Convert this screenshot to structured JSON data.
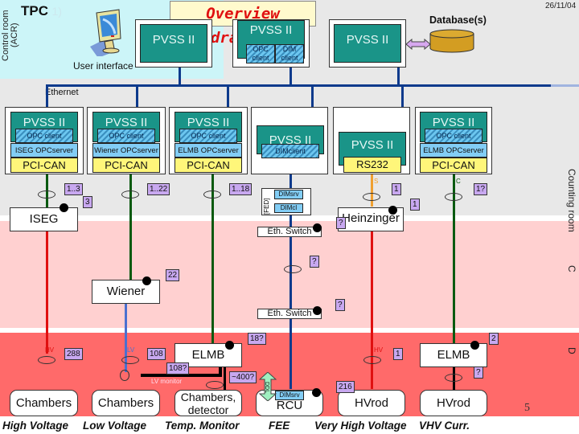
{
  "header": {
    "system": "TPC",
    "system_suffix": "1)",
    "title": "Overview drawing",
    "date": "26/11/04",
    "database_label": "Database(s)",
    "user_interface_label": "User interface",
    "control_room_label": "Control room (ACR)"
  },
  "zones": {
    "counting_room": "Counting room",
    "cavern_marker": "C",
    "detector_marker": "D"
  },
  "network": {
    "ethernet_label": "Ethernet"
  },
  "top_nodes": [
    {
      "label": "PVSS II"
    },
    {
      "label": "PVSS II",
      "opc": "OPC client",
      "dim": "DIM client"
    },
    {
      "label": "PVSS II"
    }
  ],
  "pcs": [
    {
      "pvss": "PVSS II",
      "client": "OPC client",
      "server": "ISEG OPCserver",
      "bus": "PCI-CAN"
    },
    {
      "pvss": "PVSS II",
      "client": "OPC client",
      "server": "Wiener OPCserver",
      "bus": "PCI-CAN"
    },
    {
      "pvss": "PVSS II",
      "client": "OPC client",
      "server": "ELMB OPCserver",
      "bus": "PCI-CAN"
    },
    {
      "pvss": "PVSS II",
      "client": "DIMclient"
    },
    {
      "pvss": "PVSS II",
      "bus": "RS232"
    },
    {
      "pvss": "PVSS II",
      "client": "OPC client",
      "server": "ELMB OPCserver",
      "bus": "PCI-CAN"
    }
  ],
  "fed": {
    "label": "[FED]",
    "dim_server": "DIMsrv",
    "dim_client": "DIMcl"
  },
  "devices": {
    "iseg": "ISEG",
    "wiener": "Wiener",
    "heinzinger": "Heinzinger",
    "eth_switch_1": "Eth. Switch",
    "eth_switch_2": "Eth. Switch",
    "elmb_1": "ELMB",
    "elmb_2": "ELMB",
    "rcu": "RCU",
    "rcu_dim": "DIMsrv",
    "ddl": "DDL",
    "lv_monitor": "LV monitor"
  },
  "channel_tags": {
    "iseg_can": "1..3",
    "iseg_dev": "3",
    "wiener_can": "1..22",
    "wiener_dev": "22",
    "elmb_can": "1..18",
    "heinz_rs": "1",
    "heinz_dev": "1",
    "elmb2_can": "1?",
    "ethsw1": "?",
    "ethsw_cable": "?",
    "ethsw2": "?",
    "elmb1_dev": "18?",
    "hv_cable": "288",
    "lv_cable": "108",
    "lvmon": "108?",
    "temp": "~400?",
    "rcu": "216",
    "vhv_cable": "1",
    "elmb2_dev": "2",
    "hvrod_curr": "?"
  },
  "cable_markers": {
    "hv": "HV",
    "lv": "LV",
    "vhv": "HV",
    "can": "C",
    "serial": "S"
  },
  "bottom_nodes": {
    "hv": "Chambers",
    "lv": "Chambers",
    "temp": "Chambers, detector",
    "fee": "RCU",
    "vhv": "HVrod",
    "vhv_curr": "HVrod"
  },
  "captions": [
    "High Voltage",
    "Low Voltage",
    "Temp. Monitor",
    "FEE",
    "Very High Voltage",
    "VHV Curr."
  ],
  "page_number": "5",
  "colors": {
    "pvss": "#1a9488",
    "ethernet": "#0d3a8c",
    "can_cable": "#0a5a10",
    "hv_cable": "#e01010",
    "lv_cable": "#4a70d0",
    "serial_cable": "#f0a030",
    "tag": "#c8a8f0",
    "title": "#e01010"
  }
}
